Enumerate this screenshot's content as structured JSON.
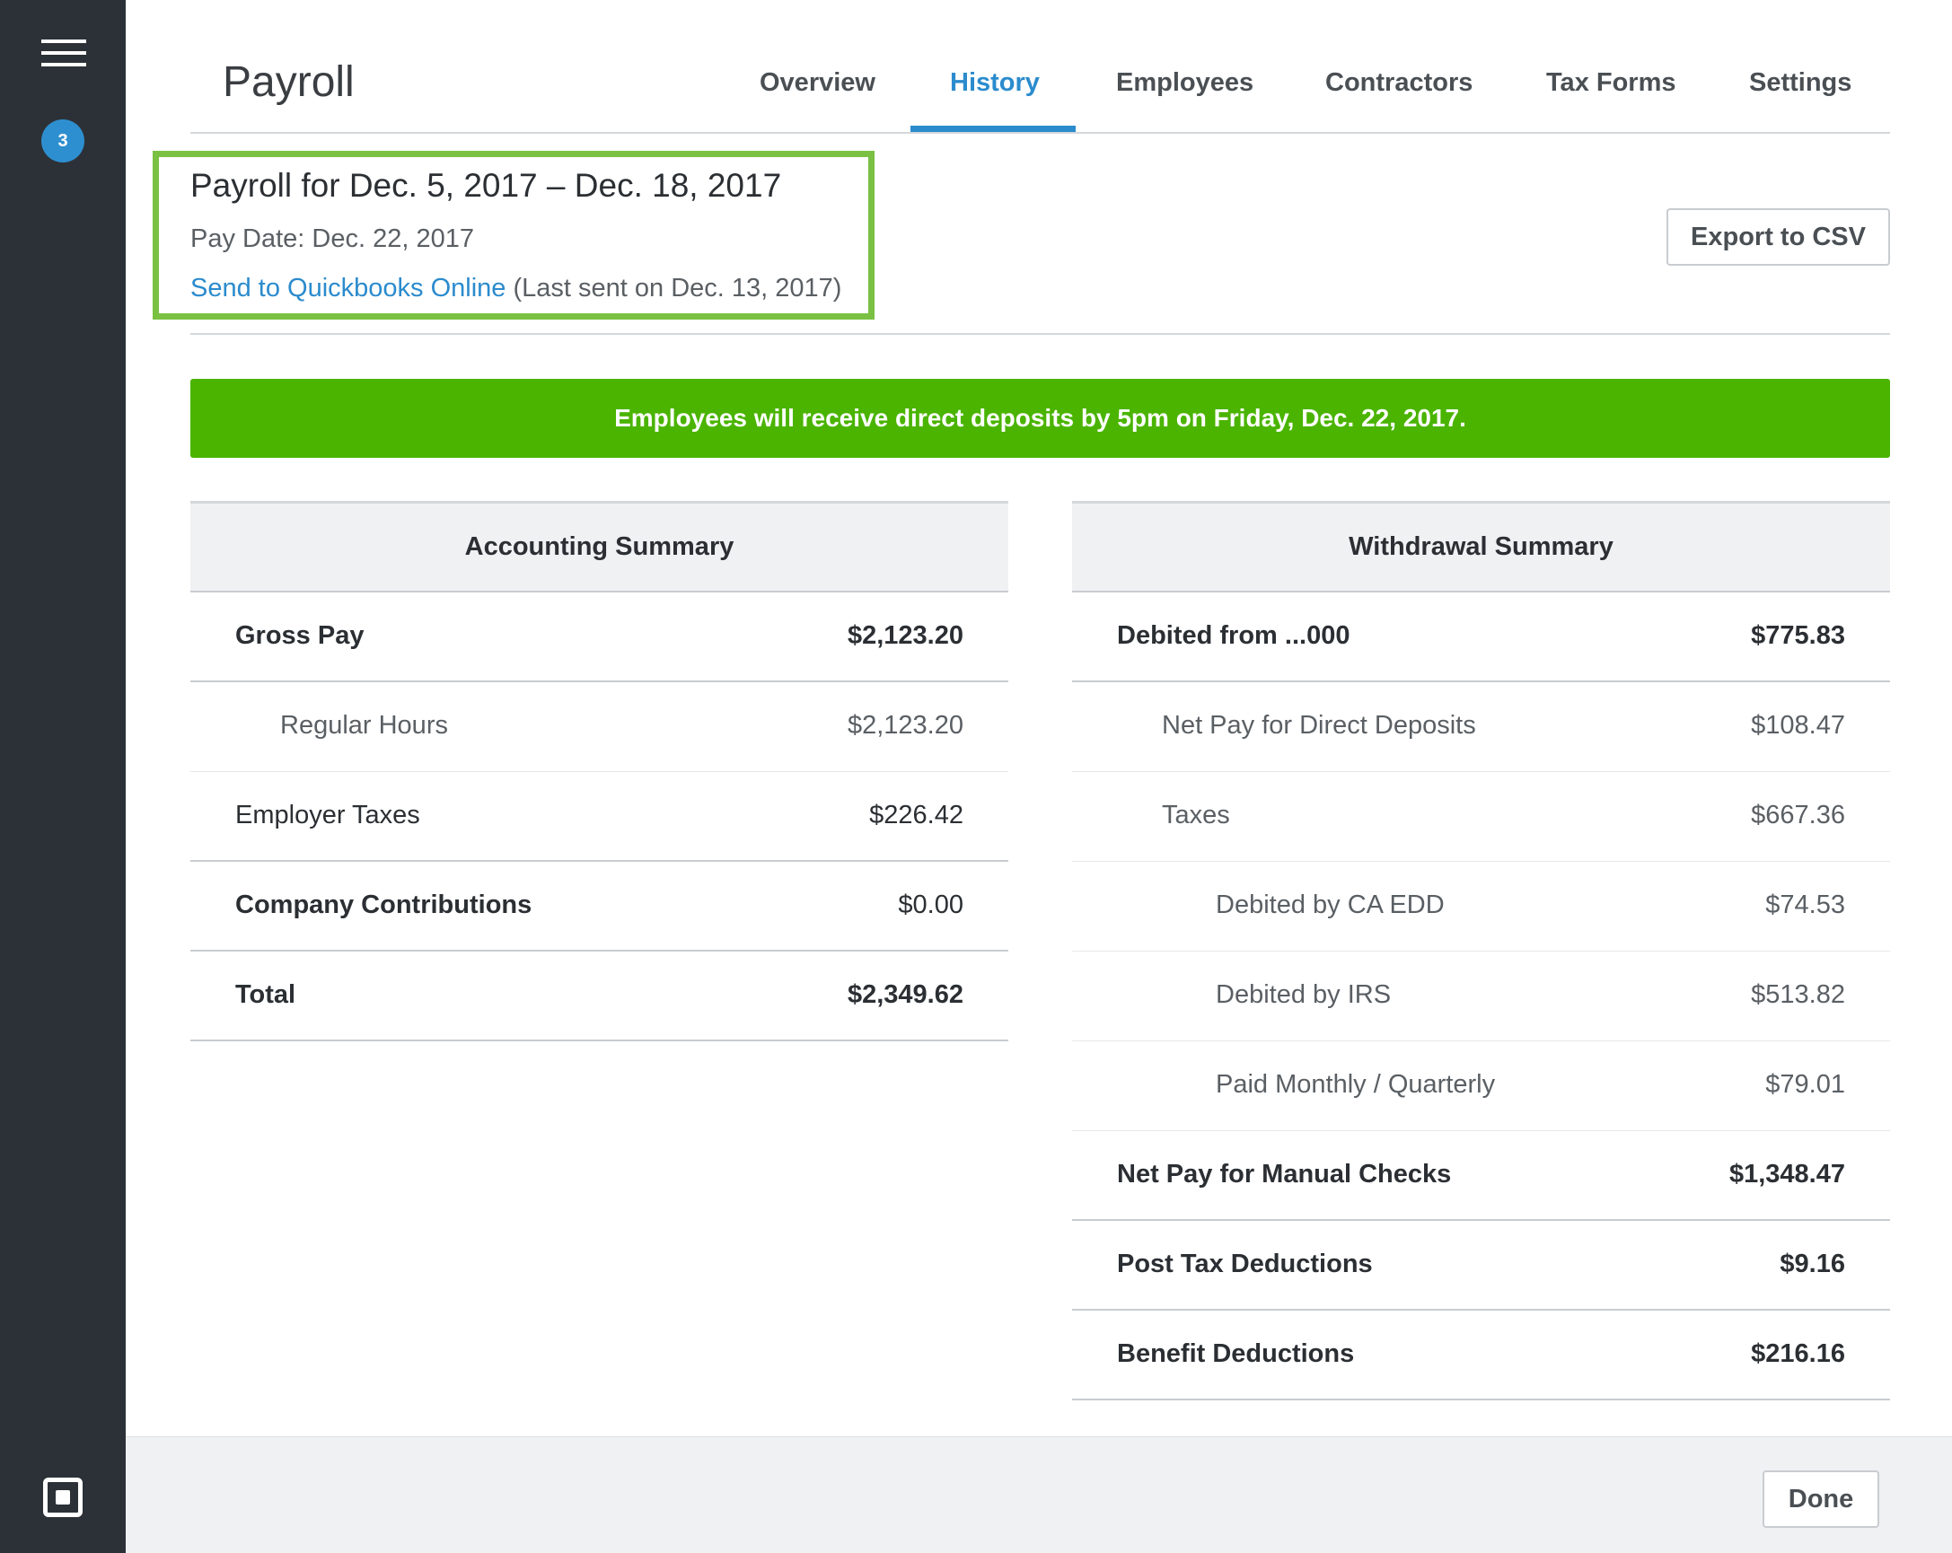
{
  "header": {
    "app_title": "Payroll",
    "tabs": [
      {
        "label": "Overview"
      },
      {
        "label": "History"
      },
      {
        "label": "Employees"
      },
      {
        "label": "Contractors"
      },
      {
        "label": "Tax Forms"
      },
      {
        "label": "Settings"
      }
    ],
    "active_tab": "History"
  },
  "sidebar": {
    "notification_count": "3",
    "menu_icon": "hamburger-menu-icon",
    "logo_icon": "square-logo-icon"
  },
  "payroll": {
    "title": "Payroll for Dec. 5, 2017 – Dec. 18, 2017",
    "pay_date": "Pay Date: Dec. 22, 2017",
    "send_link": "Send to Quickbooks Online",
    "last_sent": " (Last sent on Dec. 13, 2017)",
    "export_label": "Export to CSV"
  },
  "banner": {
    "text": "Employees will receive direct deposits by 5pm on Friday, Dec. 22, 2017.",
    "color": "#4ab400"
  },
  "accounting": {
    "title": "Accounting Summary",
    "rows": [
      {
        "label": "Gross Pay",
        "value": "$2,123.20"
      },
      {
        "label": "Regular Hours",
        "value": "$2,123.20"
      },
      {
        "label": "Employer Taxes",
        "value": "$226.42"
      },
      {
        "label": "Company Contributions",
        "value": "$0.00"
      },
      {
        "label": "Total",
        "value": "$2,349.62"
      }
    ]
  },
  "withdrawal": {
    "title": "Withdrawal Summary",
    "rows": [
      {
        "label": "Debited from ...000",
        "value": "$775.83"
      },
      {
        "label": "Net Pay for Direct Deposits",
        "value": "$108.47"
      },
      {
        "label": "Taxes",
        "value": "$667.36"
      },
      {
        "label": "Debited by CA EDD",
        "value": "$74.53"
      },
      {
        "label": "Debited by IRS",
        "value": "$513.82"
      },
      {
        "label": "Paid Monthly / Quarterly",
        "value": "$79.01"
      },
      {
        "label": "Net Pay for Manual Checks",
        "value": "$1,348.47"
      },
      {
        "label": "Post Tax Deductions",
        "value": "$9.16"
      },
      {
        "label": "Benefit Deductions",
        "value": "$216.16"
      }
    ]
  },
  "footer": {
    "done_label": "Done"
  },
  "colors": {
    "accent": "#2b8bcd",
    "highlight": "#7ac143",
    "sidebar": "#2c3137"
  }
}
